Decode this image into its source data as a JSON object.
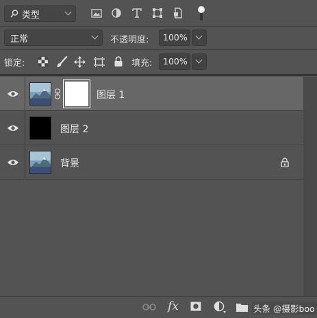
{
  "filter": {
    "kind_label": "类型"
  },
  "blend": {
    "mode_label": "正常",
    "opacity_label": "不透明度:",
    "opacity_value": "100%"
  },
  "lock": {
    "label": "锁定:",
    "fill_label": "填充:",
    "fill_value": "100%"
  },
  "layers": [
    {
      "name": "图层 1",
      "selected": true
    },
    {
      "name": "图层 2",
      "selected": false
    },
    {
      "name": "背景",
      "selected": false
    }
  ],
  "footer": {
    "fx_label": "fx",
    "watermark": "头条 @摄影boo"
  },
  "colors": {
    "panel_bg": "#535353",
    "selected_row": "#676767",
    "black_fill": "#000000",
    "mask_white": "#ffffff"
  }
}
